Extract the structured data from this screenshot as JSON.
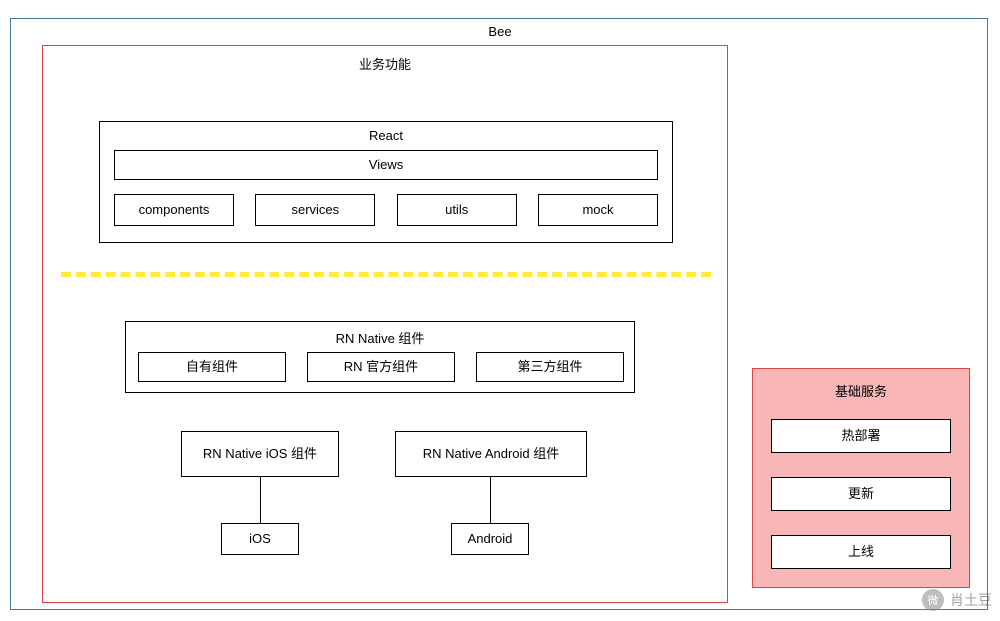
{
  "outer": {
    "title": "Bee"
  },
  "biz": {
    "title": "业务功能",
    "react": {
      "title": "React",
      "views": "Views",
      "items": [
        "components",
        "services",
        "utils",
        "mock"
      ]
    },
    "rn_native": {
      "title": "RN Native  组件",
      "items": [
        "自有组件",
        "RN 官方组件",
        "第三方组件"
      ]
    },
    "rn_ios": "RN Native iOS 组件",
    "rn_android": "RN Native Android 组件",
    "ios": "iOS",
    "android": "Android"
  },
  "services": {
    "title": "基础服务",
    "items": [
      "热部署",
      "更新",
      "上线"
    ]
  },
  "watermark": {
    "logo": "微",
    "text": "肖土豆"
  }
}
